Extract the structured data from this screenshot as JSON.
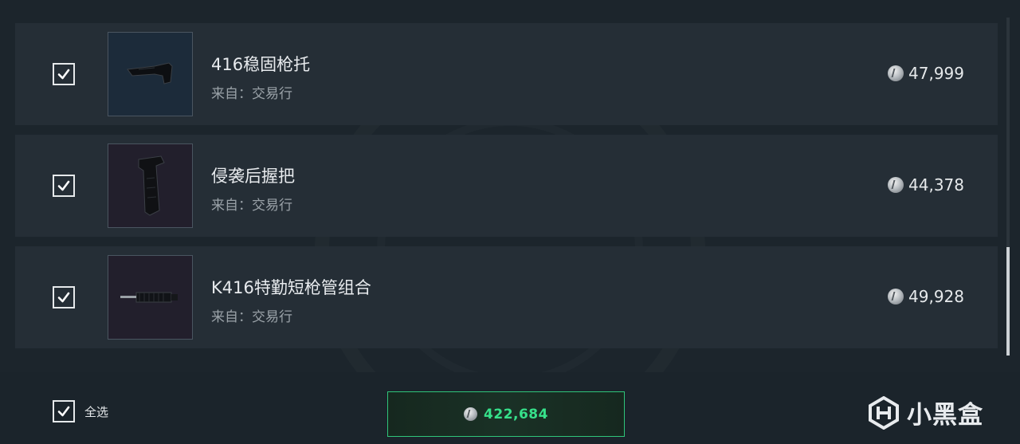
{
  "items": [
    {
      "name": "416稳固枪托",
      "source": "来自：交易行",
      "price": "47,999",
      "checked": true,
      "thumb_style": "blue",
      "icon": "rifle-stock-icon"
    },
    {
      "name": "侵袭后握把",
      "source": "来自：交易行",
      "price": "44,378",
      "checked": true,
      "thumb_style": "purple",
      "icon": "pistol-grip-icon"
    },
    {
      "name": "K416特勤短枪管组合",
      "source": "来自：交易行",
      "price": "49,928",
      "checked": true,
      "thumb_style": "purple",
      "icon": "short-barrel-icon"
    }
  ],
  "footer": {
    "select_all_label": "全选",
    "select_all_checked": true,
    "total": "422,684"
  },
  "watermark": {
    "text": "小黑盒"
  },
  "colors": {
    "accent_green": "#36e08a",
    "row_bg": "#252e36",
    "page_bg": "#1c252c"
  }
}
